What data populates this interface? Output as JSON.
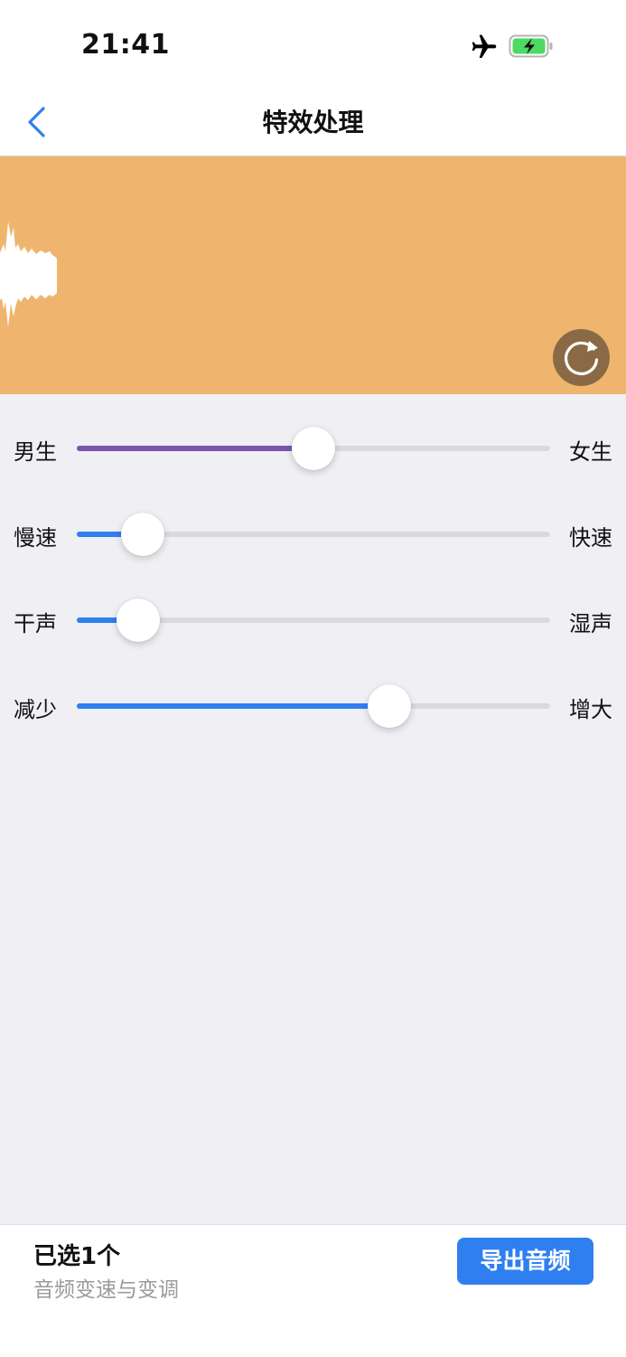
{
  "status_bar": {
    "time": "21:41",
    "airplane_icon": "airplane-icon",
    "battery_icon": "battery-charging-icon"
  },
  "nav": {
    "back_icon": "chevron-left-icon",
    "title": "特效处理"
  },
  "waveform": {
    "background": "#efb56e",
    "reset_icon": "refresh-icon"
  },
  "sliders": [
    {
      "left_label": "男生",
      "right_label": "女生",
      "value": 0.5,
      "color": "#7a55a8"
    },
    {
      "left_label": "慢速",
      "right_label": "快速",
      "value": 0.14,
      "color": "#2f7ff0"
    },
    {
      "left_label": "干声",
      "right_label": "湿声",
      "value": 0.13,
      "color": "#2f7ff0"
    },
    {
      "left_label": "减少",
      "right_label": "增大",
      "value": 0.66,
      "color": "#2f7ff0"
    }
  ],
  "bottom": {
    "selected_count": "已选1个",
    "description": "音频变速与变调",
    "export_label": "导出音频"
  },
  "colors": {
    "accent": "#2f7ff0",
    "purple": "#7a55a8"
  }
}
